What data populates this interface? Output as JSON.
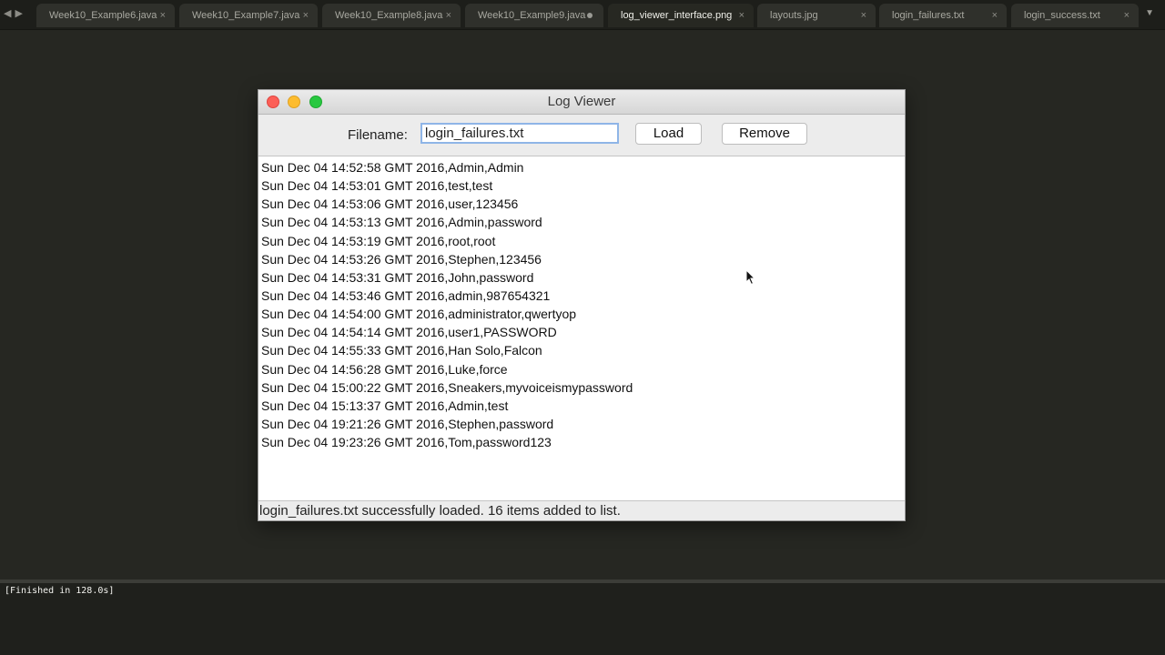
{
  "tabs": [
    {
      "label": "Week10_Example6.java",
      "state": "close"
    },
    {
      "label": "Week10_Example7.java",
      "state": "close"
    },
    {
      "label": "Week10_Example8.java",
      "state": "close"
    },
    {
      "label": "Week10_Example9.java",
      "state": "modified"
    },
    {
      "label": "log_viewer_interface.png",
      "state": "close",
      "active": true
    },
    {
      "label": "layouts.jpg",
      "state": "close"
    },
    {
      "label": "login_failures.txt",
      "state": "close"
    },
    {
      "label": "login_success.txt",
      "state": "close"
    }
  ],
  "tab_nav": {
    "back": "◀",
    "forward": "▶",
    "menu": "▼",
    "close_glyph": "×"
  },
  "window": {
    "title": "Log Viewer",
    "filename_label": "Filename:",
    "filename_value": "login_failures.txt",
    "load_button": "Load",
    "remove_button": "Remove",
    "log_entries": [
      "Sun Dec 04 14:52:58 GMT 2016,Admin,Admin",
      "Sun Dec 04 14:53:01 GMT 2016,test,test",
      "Sun Dec 04 14:53:06 GMT 2016,user,123456",
      "Sun Dec 04 14:53:13 GMT 2016,Admin,password",
      "Sun Dec 04 14:53:19 GMT 2016,root,root",
      "Sun Dec 04 14:53:26 GMT 2016,Stephen,123456",
      "Sun Dec 04 14:53:31 GMT 2016,John,password",
      "Sun Dec 04 14:53:46 GMT 2016,admin,987654321",
      "Sun Dec 04 14:54:00 GMT 2016,administrator,qwertyop",
      "Sun Dec 04 14:54:14 GMT 2016,user1,PASSWORD",
      "Sun Dec 04 14:55:33 GMT 2016,Han Solo,Falcon",
      "Sun Dec 04 14:56:28 GMT 2016,Luke,force",
      "Sun Dec 04 15:00:22 GMT 2016,Sneakers,myvoiceismypassword",
      "Sun Dec 04 15:13:37 GMT 2016,Admin,test",
      "Sun Dec 04 19:21:26 GMT 2016,Stephen,password",
      "Sun Dec 04 19:23:26 GMT 2016,Tom,password123"
    ],
    "status": "login_failures.txt successfully loaded. 16 items added to list."
  },
  "console": {
    "text": "[Finished in 128.0s]"
  },
  "colors": {
    "editor_bg": "#262722",
    "tab_active": "#272822",
    "traffic_close": "#fc5f57",
    "traffic_minimize": "#fdbc2e",
    "traffic_zoom": "#28c840",
    "focus_ring": "#8fb5e7"
  }
}
